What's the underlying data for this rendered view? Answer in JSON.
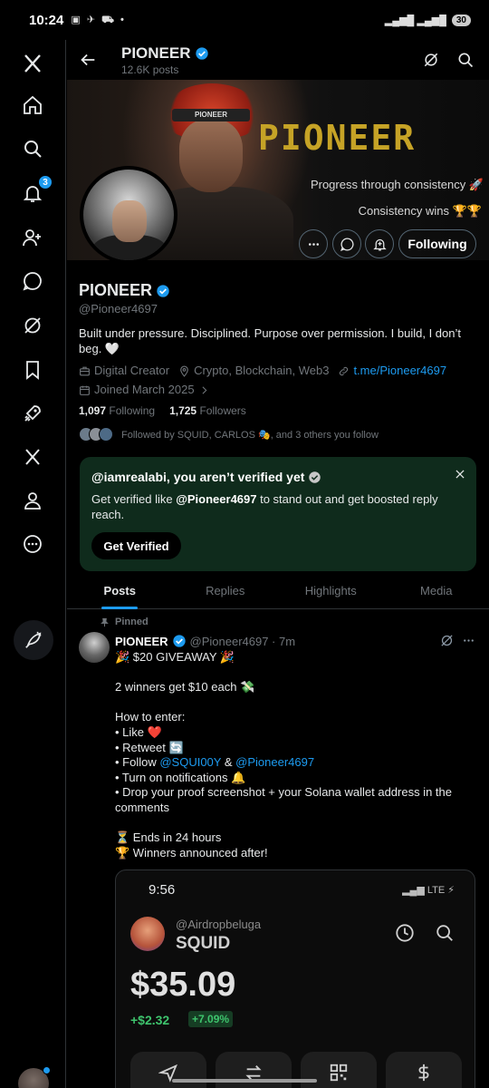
{
  "status": {
    "time": "10:24",
    "icons": "▣ ✈ ⛟ •",
    "battery": "30"
  },
  "rail": {
    "notifications_badge": "3"
  },
  "topbar": {
    "title": "PIONEER",
    "subtitle": "12.6K posts"
  },
  "banner": {
    "title": "PIONEER",
    "headband": "PIONEER",
    "line1": "Progress through consistency 🚀",
    "line2": "Consistency wins 🏆🏆"
  },
  "profile": {
    "follow_label": "Following",
    "name": "PIONEER",
    "handle": "@Pioneer4697",
    "bio": "Built under pressure. Disciplined. Purpose over permission. I build, I don’t beg. 🤍",
    "category": "Digital Creator",
    "location": "Crypto, Blockchain, Web3",
    "link": "t.me/Pioneer4697",
    "joined": "Joined March 2025",
    "following_count": "1,097",
    "following_label": "Following",
    "followers_count": "1,725",
    "followers_label": "Followers",
    "followed_by": "Followed by SQUID, CARLOS 🎭, and 3 others you follow"
  },
  "verify_card": {
    "title": "@iamrealabi, you aren’t verified yet",
    "desc_prefix": "Get verified like ",
    "desc_handle": "@Pioneer4697",
    "desc_suffix": " to stand out and get boosted reply reach.",
    "button": "Get Verified"
  },
  "tabs": [
    "Posts",
    "Replies",
    "Highlights",
    "Media"
  ],
  "post": {
    "pinned_label": "Pinned",
    "author": "PIONEER",
    "meta": "@Pioneer4697 · 7m",
    "lines": [
      "🎉 $20 GIVEAWAY 🎉",
      "",
      "2 winners get $10 each 💸",
      "",
      "How to enter:",
      "• Like ❤️",
      "• Retweet 🔄"
    ],
    "follow_prefix": "• Follow ",
    "mention1": "@SQUI00Y",
    "follow_and": " & ",
    "mention2": "@Pioneer4697",
    "lines2": [
      "• Turn on notifications 🔔",
      "• Drop your proof screenshot + your Solana wallet address in the comments",
      "",
      "⏳ Ends in 24 hours",
      "🏆 Winners announced after!"
    ]
  },
  "embed": {
    "time": "9:56",
    "net": "▂▄▆ LTE ⚡",
    "handle": "@Airdropbeluga",
    "name": "SQUID",
    "balance": "$35.09",
    "change": "+$2.32",
    "change_pct": "+7.09%"
  }
}
